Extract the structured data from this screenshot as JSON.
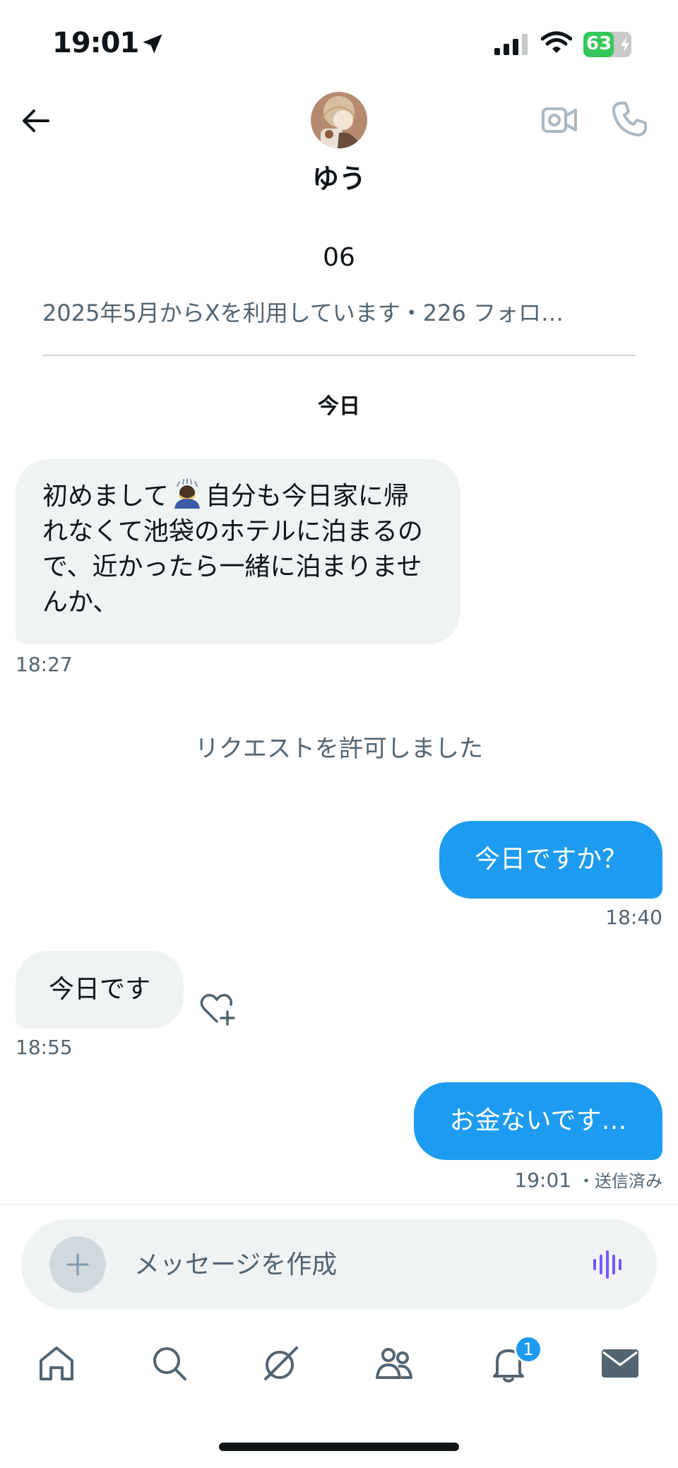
{
  "status_bar": {
    "time": "19:01",
    "battery": "63",
    "battery_level": 0.63,
    "icons": [
      "location-arrow-icon",
      "signal-icon",
      "wifi-icon",
      "battery-charging-icon"
    ]
  },
  "header": {
    "contact_name": "ゆう",
    "icons": [
      "back-arrow-icon",
      "video-call-icon",
      "phone-call-icon"
    ]
  },
  "profile": {
    "handle": "06",
    "meta": "2025年5月からXを利用しています・226 フォロ…"
  },
  "conversation": {
    "day_label": "今日",
    "messages": [
      {
        "direction": "incoming",
        "text_before": "初めまして",
        "emoji": "bowing-person-emoji",
        "text_after": "自分も今日家に帰れなくて池袋のホテルに泊まるので、近かったら一緒に泊まりませんか、",
        "time": "18:27"
      },
      {
        "direction": "outgoing",
        "text": "今日ですか？",
        "time": "18:40"
      },
      {
        "direction": "incoming",
        "text": "今日です",
        "time": "18:55"
      },
      {
        "direction": "outgoing",
        "text": "お金ないです…",
        "time": "19:01",
        "status": "・送信済み"
      }
    ],
    "system_message": "リクエストを許可しました"
  },
  "composer": {
    "placeholder": "メッセージを作成",
    "icons": [
      "plus-icon",
      "voice-waveform-icon"
    ]
  },
  "tab_bar": {
    "items": [
      "home",
      "search",
      "grok",
      "communities",
      "notifications",
      "messages"
    ],
    "notification_count": "1"
  },
  "colors": {
    "accent": "#1d9bf0",
    "incoming_bubble": "#eff3f4",
    "secondary_text": "#536471",
    "voice_icon": "#7856ff",
    "battery_green": "#34c759"
  }
}
